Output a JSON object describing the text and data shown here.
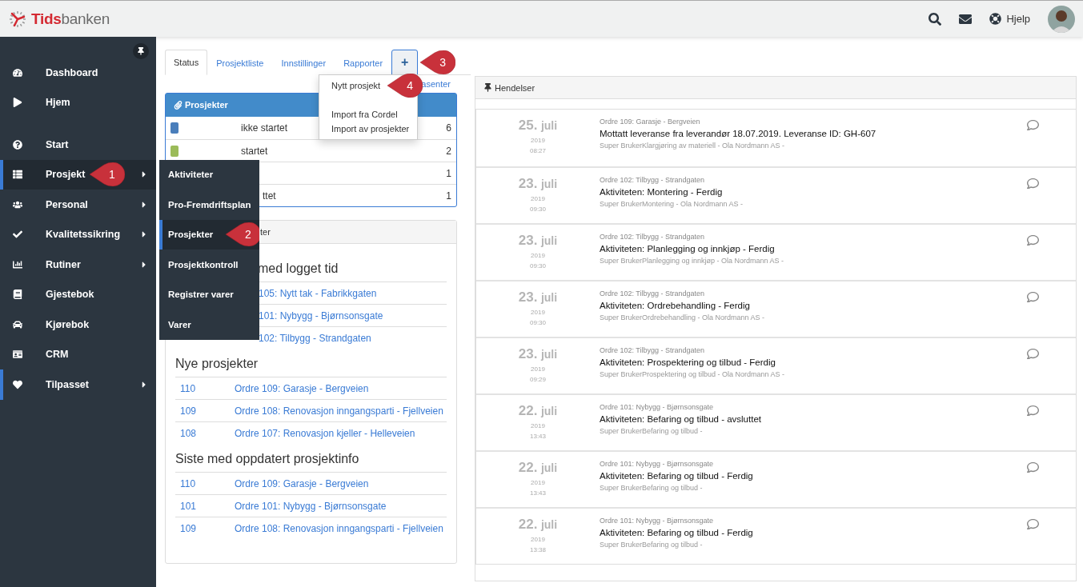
{
  "topbar": {
    "logo": {
      "lead": "Tids",
      "rest": "banken"
    },
    "help": "Hjelp"
  },
  "sidebar": {
    "groups": [
      [
        {
          "label": "Dashboard",
          "has_submenu": false,
          "selected": false,
          "open": false
        },
        {
          "label": "Hjem",
          "has_submenu": false,
          "selected": false,
          "open": false
        }
      ],
      [
        {
          "label": "Start",
          "has_submenu": false,
          "selected": false,
          "open": false
        },
        {
          "label": "Prosjekt",
          "has_submenu": true,
          "selected": true,
          "open": true,
          "callout": "1",
          "submenu": [
            {
              "label": "Aktiviteter",
              "selected": false
            },
            {
              "label": "Pro-Fremdriftsplan",
              "selected": false
            },
            {
              "label": "Prosjekter",
              "selected": true,
              "callout": "2"
            },
            {
              "label": "Prosjektkontroll",
              "selected": false
            },
            {
              "label": "Registrer varer",
              "selected": false
            },
            {
              "label": "Varer",
              "selected": false
            }
          ]
        },
        {
          "label": "Personal",
          "has_submenu": true,
          "selected": false,
          "open": false
        },
        {
          "label": "Kvalitetssikring",
          "has_submenu": true,
          "selected": false,
          "open": false
        },
        {
          "label": "Rutiner",
          "has_submenu": true,
          "selected": false,
          "open": false
        },
        {
          "label": "Gjestebok",
          "has_submenu": false,
          "selected": false,
          "open": false
        },
        {
          "label": "Kjørebok",
          "has_submenu": false,
          "selected": false,
          "open": false
        },
        {
          "label": "CRM",
          "has_submenu": false,
          "selected": false,
          "open": false
        },
        {
          "label": "Tilpasset",
          "has_submenu": true,
          "selected": true,
          "open": false
        }
      ]
    ]
  },
  "tabs": [
    {
      "label": "Status",
      "selected": true
    },
    {
      "label": "Prosjektliste",
      "selected": false
    },
    {
      "label": "Innstillinger",
      "selected": false
    },
    {
      "label": "Rapporter",
      "selected": false
    }
  ],
  "add_tab": {
    "label": "+",
    "callout": "3",
    "menu": [
      {
        "label": "Nytt prosjekt",
        "callout": "4"
      },
      {
        "label": "Import fra Cordel"
      },
      {
        "label": "Import av prosjekter"
      }
    ]
  },
  "link": "asenter",
  "status_card": {
    "title": "Prosjekter",
    "rows": [
      {
        "color": "#4a7ebb",
        "label": "ikke startet",
        "count": "6"
      },
      {
        "color": "#9bbb59",
        "label": "startet",
        "count": "2"
      },
      {
        "count": "1"
      },
      {
        "label": "ttet",
        "count": "1"
      }
    ]
  },
  "projects_card": {
    "title": "ter",
    "sections": [
      {
        "heading": "med logget tid",
        "rows": [
          {
            "link": "105: Nytt tak - Fabrikkgaten"
          },
          {
            "link": "101: Nybygg - Bjørnsonsgate"
          },
          {
            "link": "102: Tilbygg - Strandgaten"
          }
        ]
      },
      {
        "heading": "Nye prosjekter",
        "rows": [
          {
            "number": "110",
            "link": "Ordre 109: Garasje - Bergveien"
          },
          {
            "number": "109",
            "link": "Ordre 108: Renovasjon inngangsparti - Fjellveien"
          },
          {
            "number": "108",
            "link": "Ordre 107: Renovasjon kjeller - Helleveien"
          }
        ]
      },
      {
        "heading": "Siste med oppdatert prosjektinfo",
        "rows": [
          {
            "number": "110",
            "link": "Ordre 109: Garasje - Bergveien"
          },
          {
            "number": "101",
            "link": "Ordre 101: Nybygg - Bjørnsonsgate"
          },
          {
            "number": "109",
            "link": "Ordre 108: Renovasjon inngangsparti - Fjellveien"
          }
        ]
      }
    ]
  },
  "events": {
    "title": "Hendelser",
    "items": [
      {
        "day": "25.",
        "month": "juli",
        "year": "2019",
        "time": "08:27",
        "order": "Ordre 109: Garasje - Bergveien",
        "title": "Mottatt leveranse fra leverandør 18.07.2019. Leveranse ID: GH-607",
        "meta": "Super BrukerKlargjøring av materiell - Ola Nordmann AS -"
      },
      {
        "day": "23.",
        "month": "juli",
        "year": "2019",
        "time": "09:30",
        "order": "Ordre 102: Tilbygg - Strandgaten",
        "title": "Aktiviteten: Montering - Ferdig",
        "meta": "Super BrukerMontering - Ola Nordmann AS -"
      },
      {
        "day": "23.",
        "month": "juli",
        "year": "2019",
        "time": "09:30",
        "order": "Ordre 102: Tilbygg - Strandgaten",
        "title": "Aktiviteten: Planlegging og innkjøp - Ferdig",
        "meta": "Super BrukerPlanlegging og innkjøp - Ola Nordmann AS -"
      },
      {
        "day": "23.",
        "month": "juli",
        "year": "2019",
        "time": "09:30",
        "order": "Ordre 102: Tilbygg - Strandgaten",
        "title": "Aktiviteten: Ordrebehandling - Ferdig",
        "meta": "Super BrukerOrdrebehandling - Ola Nordmann AS -"
      },
      {
        "day": "23.",
        "month": "juli",
        "year": "2019",
        "time": "09:29",
        "order": "Ordre 102: Tilbygg - Strandgaten",
        "title": "Aktiviteten: Prospektering og tilbud - Ferdig",
        "meta": "Super BrukerProspektering og tilbud - Ola Nordmann AS -"
      },
      {
        "day": "22.",
        "month": "juli",
        "year": "2019",
        "time": "13:43",
        "order": "Ordre 101: Nybygg - Bjørnsonsgate",
        "title": "Aktiviteten: Befaring og tilbud - avsluttet",
        "meta": "Super BrukerBefaring og tilbud -"
      },
      {
        "day": "22.",
        "month": "juli",
        "year": "2019",
        "time": "13:43",
        "order": "Ordre 101: Nybygg - Bjørnsonsgate",
        "title": "Aktiviteten: Befaring og tilbud - Ferdig",
        "meta": "Super BrukerBefaring og tilbud -"
      },
      {
        "day": "22.",
        "month": "juli",
        "year": "2019",
        "time": "13:38",
        "order": "Ordre 101: Nybygg - Bjørnsonsgate",
        "title": "Aktiviteten: Befaring og tilbud - Ferdig",
        "meta": "Super BrukerBefaring og tilbud -"
      }
    ]
  }
}
